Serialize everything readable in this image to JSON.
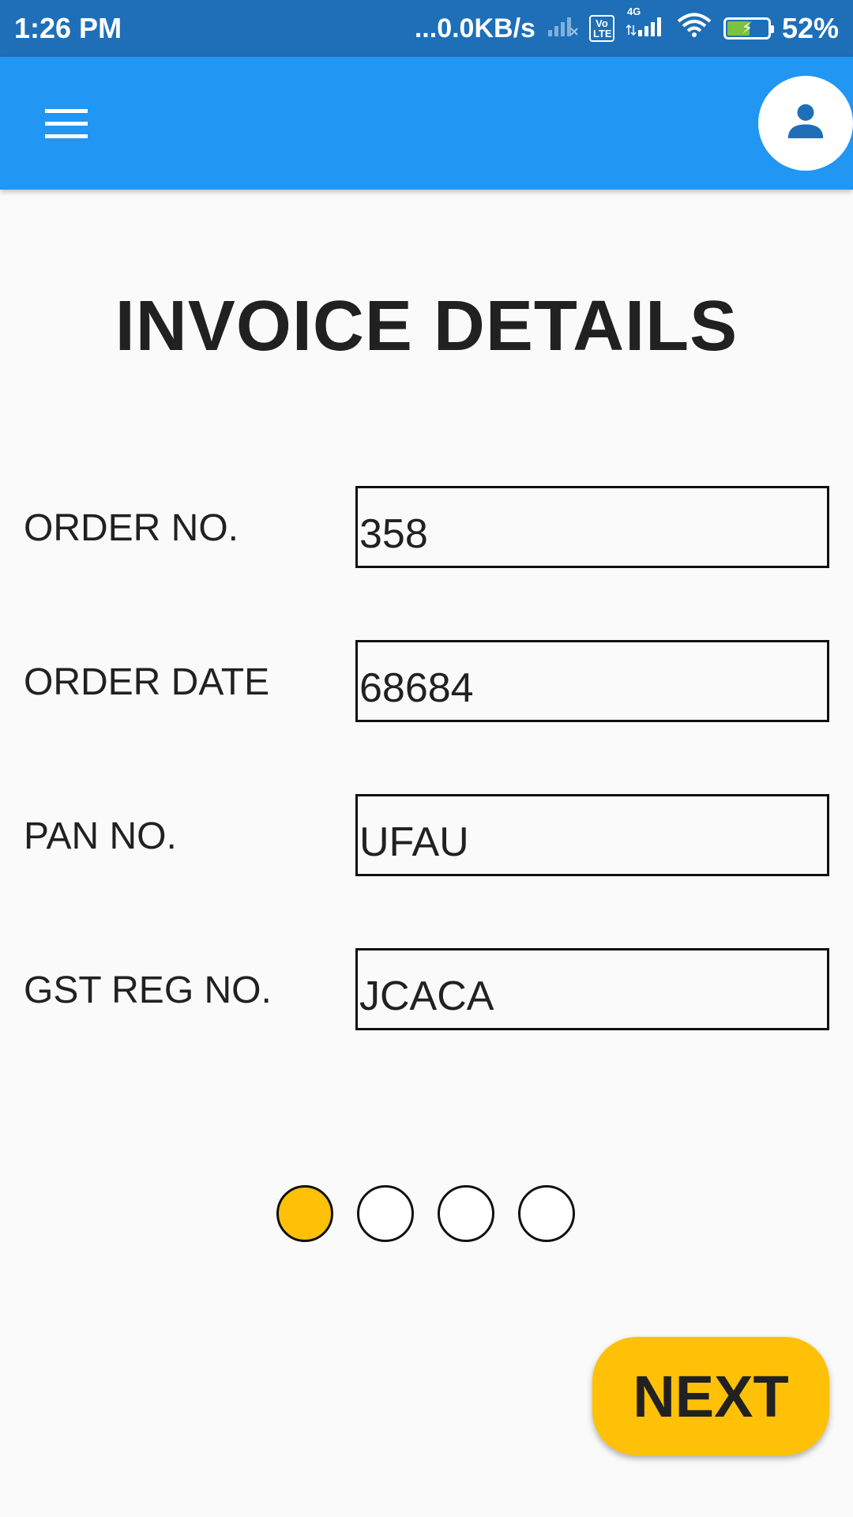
{
  "status_bar": {
    "time": "1:26 PM",
    "network_speed": "...0.0KB/s",
    "volte": "Vo LTE",
    "network_type": "4G",
    "battery_percent": "52%",
    "battery_level": 0.52,
    "icons": [
      "signal-empty-icon",
      "volte-icon",
      "signal-4g-icon",
      "wifi-icon",
      "battery-charging-icon"
    ]
  },
  "app_bar": {
    "background": "#2196f3",
    "menu_icon": "hamburger-menu-icon",
    "profile_icon": "person-icon",
    "profile_icon_color": "#1e6fb8"
  },
  "page": {
    "title": "INVOICE DETAILS"
  },
  "form": {
    "fields": [
      {
        "label": "ORDER NO.",
        "value": "358"
      },
      {
        "label": "ORDER DATE",
        "value": "68684"
      },
      {
        "label": "PAN NO.",
        "value": "UFAU"
      },
      {
        "label": "GST REG NO.",
        "value": "JCACA"
      }
    ]
  },
  "pager": {
    "total": 4,
    "current": 1,
    "active_color": "#ffc107"
  },
  "actions": {
    "next_label": "NEXT",
    "next_color": "#ffc107"
  }
}
